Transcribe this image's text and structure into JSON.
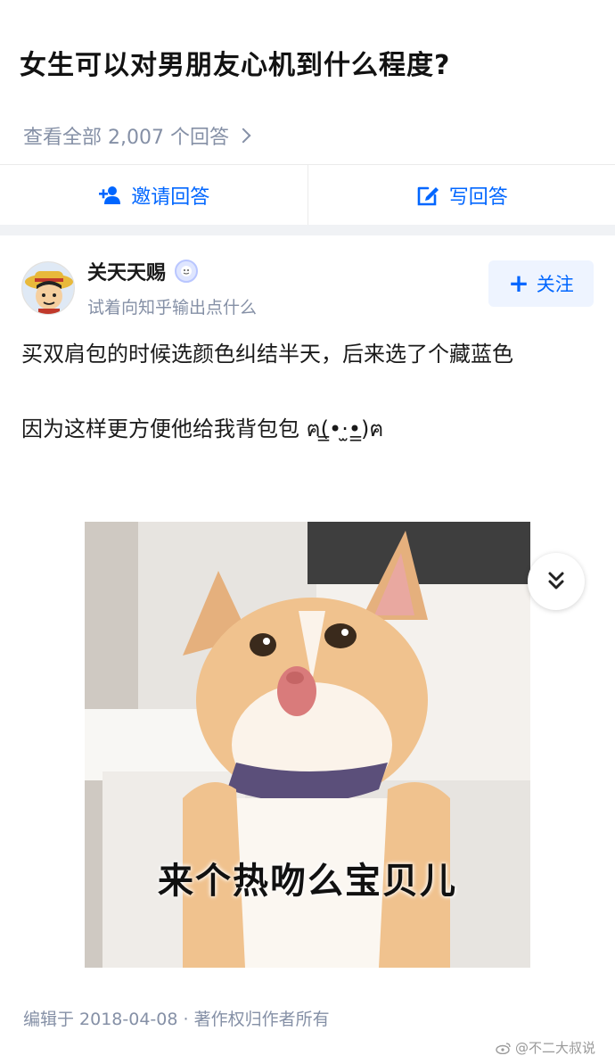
{
  "question": {
    "title": "女生可以对男朋友心机到什么程度?",
    "view_all": "查看全部 2,007 个回答"
  },
  "actions": {
    "invite_label": "邀请回答",
    "write_label": "写回答"
  },
  "author": {
    "name": "关天天赐",
    "bio": "试着向知乎输出点什么",
    "follow_label": "关注"
  },
  "answer": {
    "paragraph1": "买双肩包的时候选颜色纠结半天，后来选了个藏蓝色",
    "paragraph2": "因为这样更方便他给我背包包 ฅ(̳•·̫•̳)ฅ",
    "image_caption": "来个热吻么宝贝儿"
  },
  "footer": {
    "meta": "编辑于 2018-04-08 · 著作权归作者所有",
    "watermark": "@不二大叔说"
  },
  "colors": {
    "accent": "#0066ff",
    "muted": "#8590a6",
    "divider": "#f0f2f5"
  }
}
